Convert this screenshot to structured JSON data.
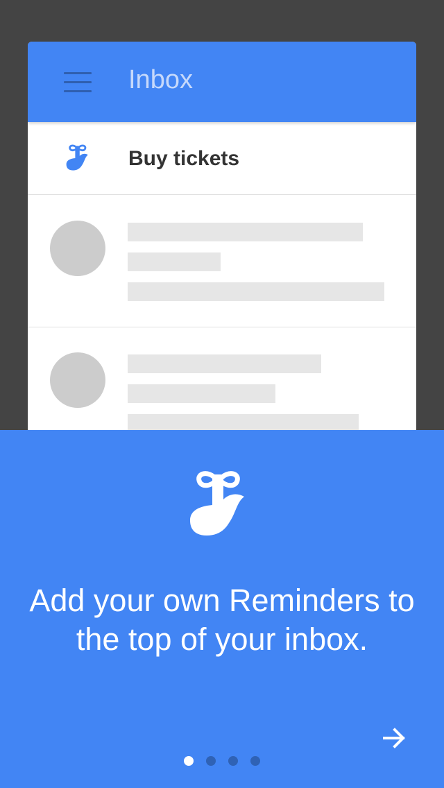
{
  "appbar": {
    "title": "Inbox"
  },
  "reminder": {
    "label": "Buy tickets",
    "icon": "reminder-finger-icon"
  },
  "onboarding": {
    "message": "Add your own Reminders to the top of your inbox.",
    "next_icon": "arrow-right-icon",
    "page_count": 4,
    "active_page": 1
  },
  "colors": {
    "accent": "#4285f4",
    "background": "#444444",
    "placeholder": "#e6e6e6",
    "avatar": "#cccccc"
  }
}
